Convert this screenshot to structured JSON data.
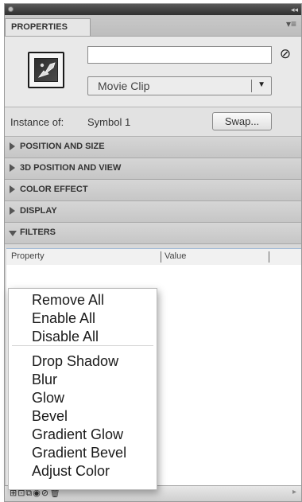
{
  "panel": {
    "tab_label": "PROPERTIES",
    "tab_menu_icon": "panel-menu-icon"
  },
  "instance": {
    "name_value": "",
    "type_select": "Movie Clip",
    "instance_of_label": "Instance of:",
    "instance_of_value": "Symbol 1",
    "swap_label": "Swap..."
  },
  "sections": [
    {
      "label": "POSITION AND SIZE",
      "expanded": false
    },
    {
      "label": "3D POSITION AND VIEW",
      "expanded": false
    },
    {
      "label": "COLOR EFFECT",
      "expanded": false
    },
    {
      "label": "DISPLAY",
      "expanded": false
    },
    {
      "label": "FILTERS",
      "expanded": true
    }
  ],
  "filters_table": {
    "col_property": "Property",
    "col_value": "Value"
  },
  "context_menu": {
    "group1": [
      "Remove All",
      "Enable All",
      "Disable All"
    ],
    "group2": [
      "Drop Shadow",
      "Blur",
      "Glow",
      "Bevel",
      "Gradient Glow",
      "Gradient Bevel",
      "Adjust Color"
    ]
  }
}
